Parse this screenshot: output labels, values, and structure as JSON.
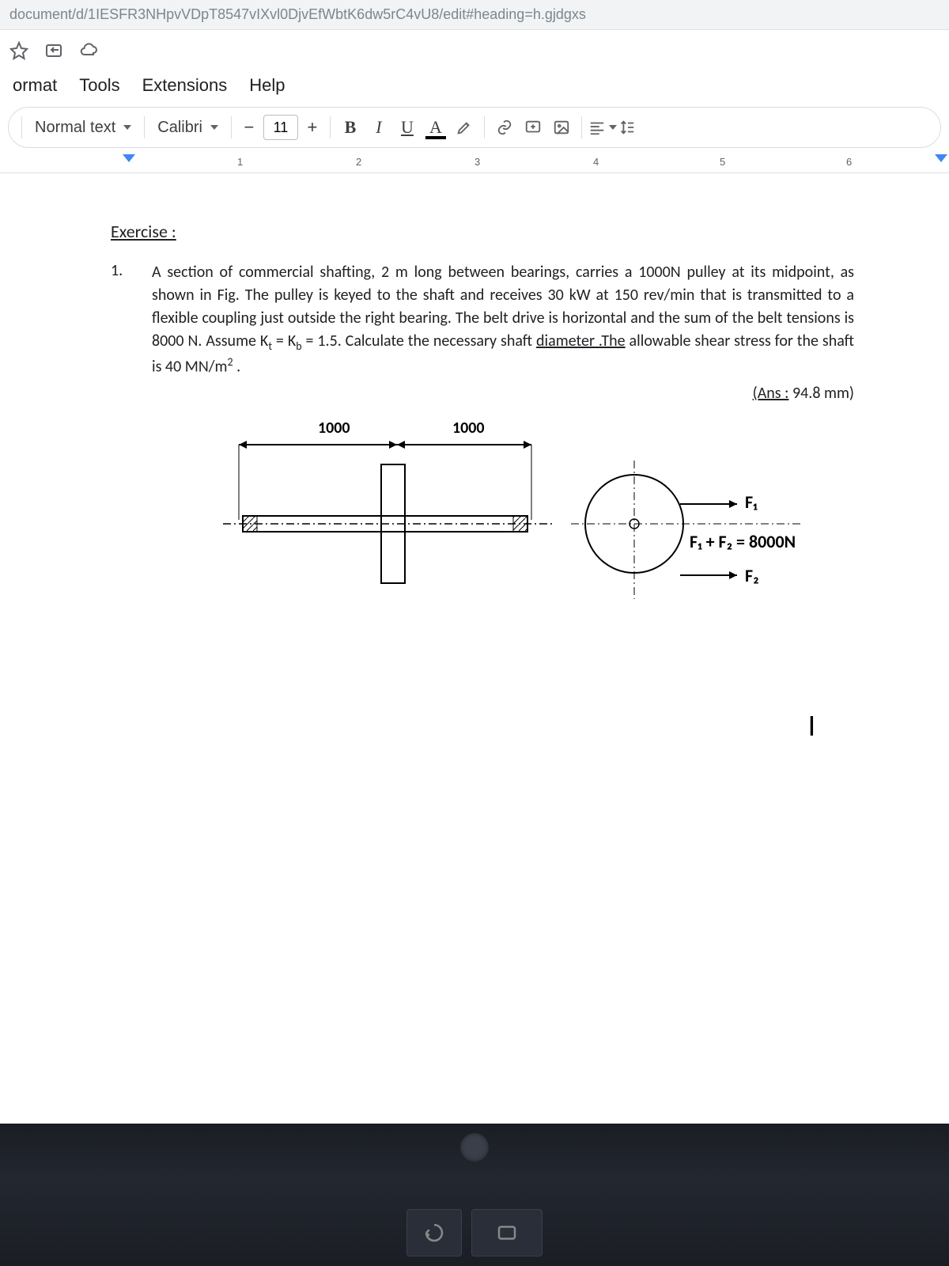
{
  "url": "document/d/1IESFR3NHpvVDpT8547vIXvl0DjvEfWbtK6dw5rC4vU8/edit#heading=h.gjdgxs",
  "menu": {
    "format": "ormat",
    "tools": "Tools",
    "extensions": "Extensions",
    "help": "Help"
  },
  "toolbar": {
    "style": "Normal text",
    "font": "Calibri",
    "minus": "−",
    "size": "11",
    "plus": "+",
    "bold": "B",
    "italic": "I",
    "underline": "U",
    "textcolor": "A"
  },
  "ruler": {
    "n1": "1",
    "n2": "2",
    "n3": "3",
    "n4": "4",
    "n5": "5",
    "n6": "6"
  },
  "doc": {
    "title": "Exercise :",
    "num": "1.",
    "p": "A section of commercial shafting, 2 m long between bearings, carries a 1000N pulley at its midpoint, as shown in Fig. The pulley is keyed to the shaft and receives 30 kW at 150 rev/min that is transmitted to a flexible coupling just outside the right bearing. The belt drive is horizontal and the sum of the belt tensions is 8000 N. Assume K",
    "kt_sub": "t",
    "eq": " = K",
    "kb_sub": "b",
    "after": " = 1.5. Calculate the necessary shaft ",
    "diam": "diameter .The",
    "tail": " allowable shear stress for the shaft is 40 MN/m",
    "sq": "2",
    "dot": " .",
    "ans_label": "(Ans :",
    "ans_val": " 94.8 mm)",
    "dim": "1000",
    "f1": "F₁",
    "sum": "F₁ + F₂ = 8000N",
    "f2": "F₂"
  }
}
